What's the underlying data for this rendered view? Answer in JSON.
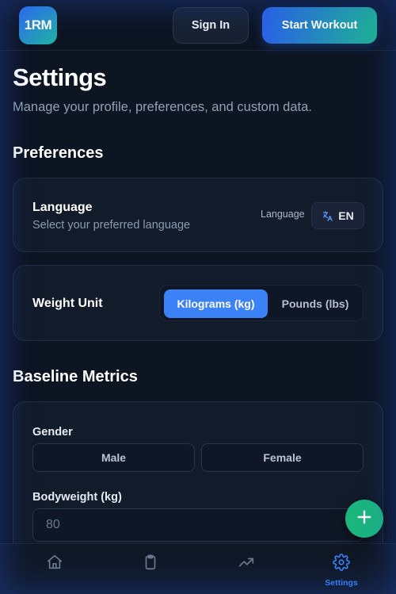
{
  "header": {
    "logo_text": "1RM",
    "sign_in_label": "Sign In",
    "start_workout_label": "Start Workout"
  },
  "page": {
    "title": "Settings",
    "subtitle": "Manage your profile, preferences, and custom data."
  },
  "preferences": {
    "section_title": "Preferences",
    "language": {
      "label": "Language",
      "description": "Select your preferred language",
      "caption": "Language",
      "value": "EN",
      "icon": "translate-icon"
    },
    "weight_unit": {
      "label": "Weight Unit",
      "options": [
        "Kilograms (kg)",
        "Pounds (lbs)"
      ],
      "selected": "Kilograms (kg)"
    }
  },
  "baseline": {
    "section_title": "Baseline Metrics",
    "gender": {
      "label": "Gender",
      "options": [
        "Male",
        "Female"
      ]
    },
    "bodyweight": {
      "label": "Bodyweight (kg)",
      "placeholder": "80"
    }
  },
  "nav": {
    "items": [
      {
        "icon": "home-icon",
        "label": ""
      },
      {
        "icon": "clipboard-icon",
        "label": ""
      },
      {
        "icon": "trending-up-icon",
        "label": ""
      },
      {
        "icon": "gear-icon",
        "label": "Settings"
      }
    ],
    "active": "Settings"
  },
  "colors": {
    "accent": "#3b82f6",
    "fab": "#1bb57e",
    "background": "#0d1422"
  }
}
